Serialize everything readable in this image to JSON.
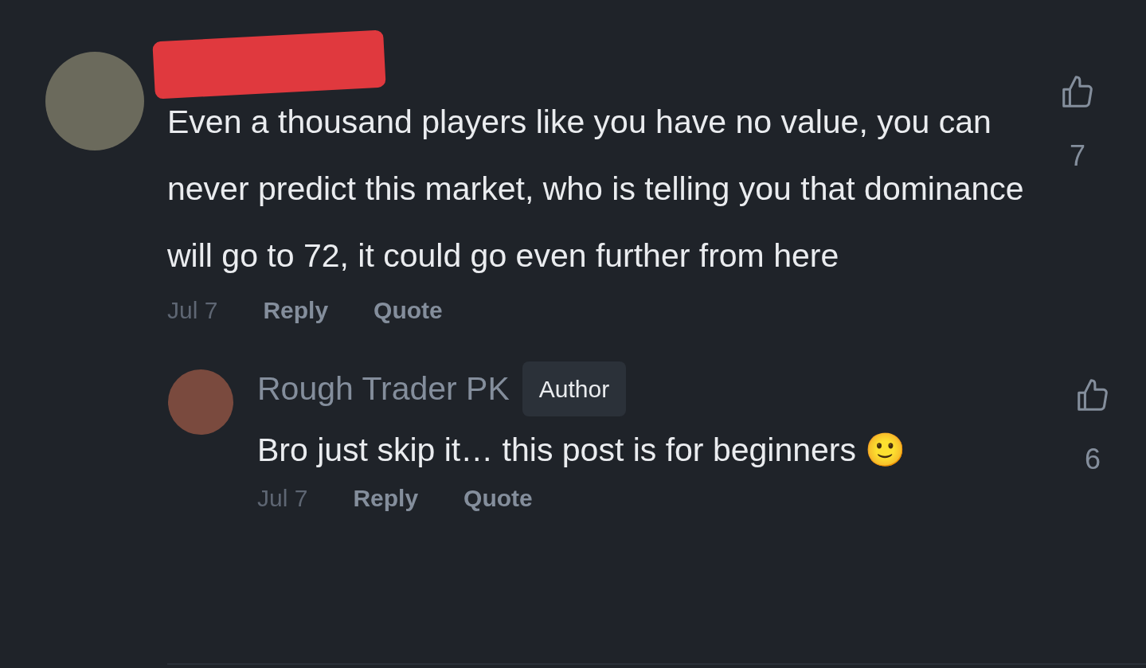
{
  "comment": {
    "text": "Even a thousand players like you have no value, you can never predict this market, who is telling you that dominance will go to 72, it could go even further from here",
    "date": "Jul 7",
    "actions": [
      "Reply",
      "Quote"
    ],
    "likes": "7"
  },
  "reply": {
    "author": "Rough Trader PK",
    "badge": "Author",
    "text": "Bro just skip it… this post is for beginners 🙂",
    "date": "Jul 7",
    "actions": [
      "Reply",
      "Quote"
    ],
    "likes": "6"
  }
}
